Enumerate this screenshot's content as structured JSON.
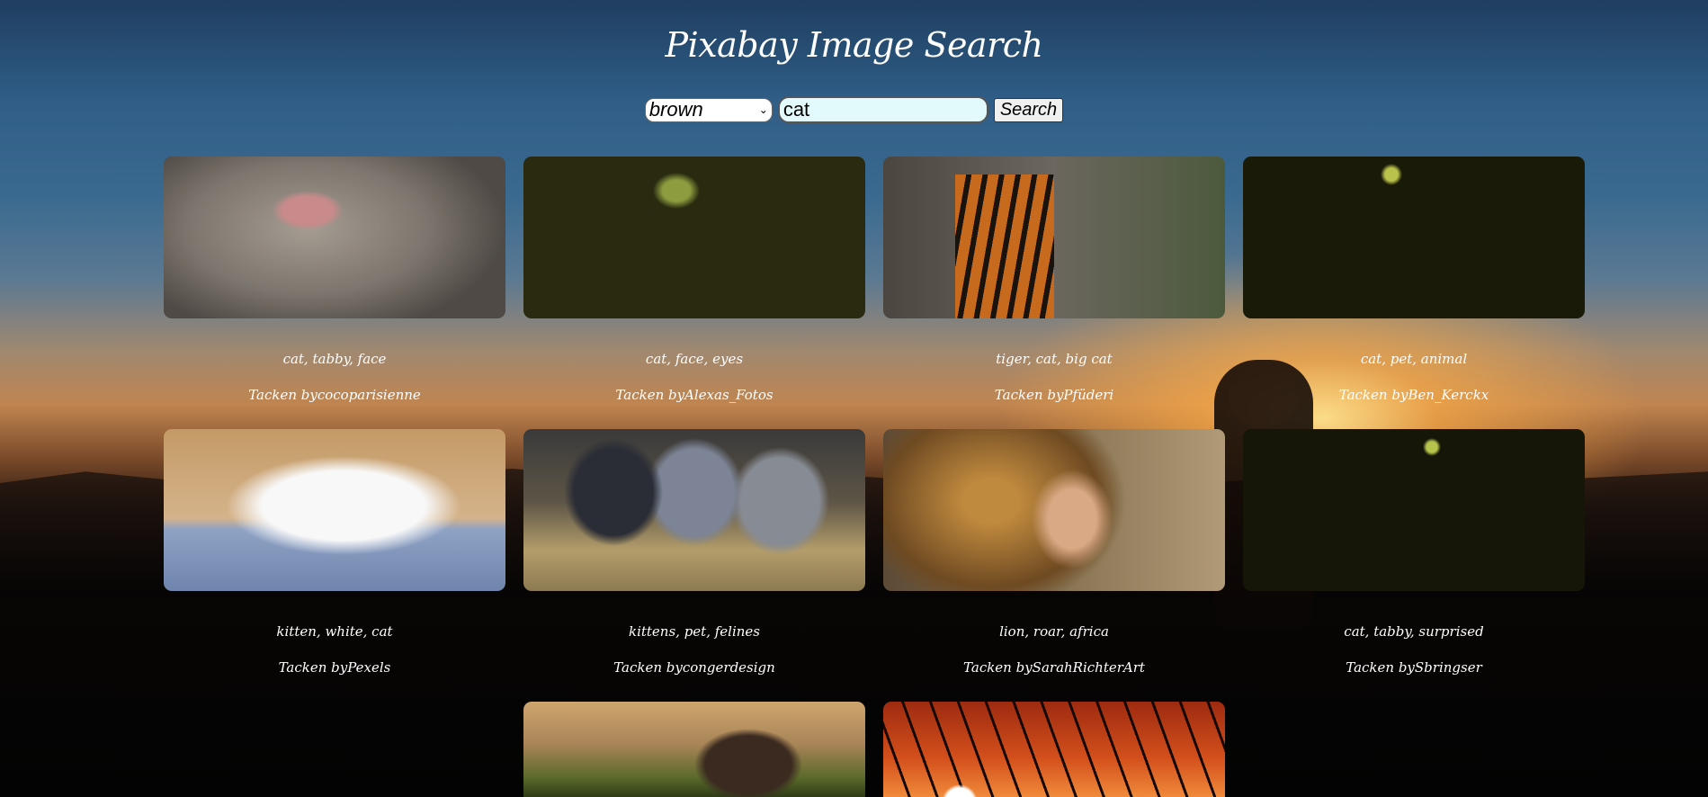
{
  "header": {
    "title": "Pixabay Image Search"
  },
  "search": {
    "color_selected": "brown",
    "query": "cat",
    "button_label": "Search"
  },
  "results": [
    {
      "tags": "cat, tabby, face",
      "credit": "Tacken bycocoparisienne"
    },
    {
      "tags": "cat, face, eyes",
      "credit": "Tacken byAlexas_Fotos"
    },
    {
      "tags": "tiger, cat, big cat",
      "credit": "Tacken byPfüderi"
    },
    {
      "tags": "cat, pet, animal",
      "credit": "Tacken byBen_Kerckx"
    },
    {
      "tags": "kitten, white, cat",
      "credit": "Tacken byPexels"
    },
    {
      "tags": "kittens, pet, felines",
      "credit": "Tacken bycongerdesign"
    },
    {
      "tags": "lion, roar, africa",
      "credit": "Tacken bySarahRichterArt"
    },
    {
      "tags": "cat, tabby, surprised",
      "credit": "Tacken bySbringser"
    }
  ],
  "colors": {
    "input_bg": "#e3fafd",
    "text": "#ffffff"
  }
}
